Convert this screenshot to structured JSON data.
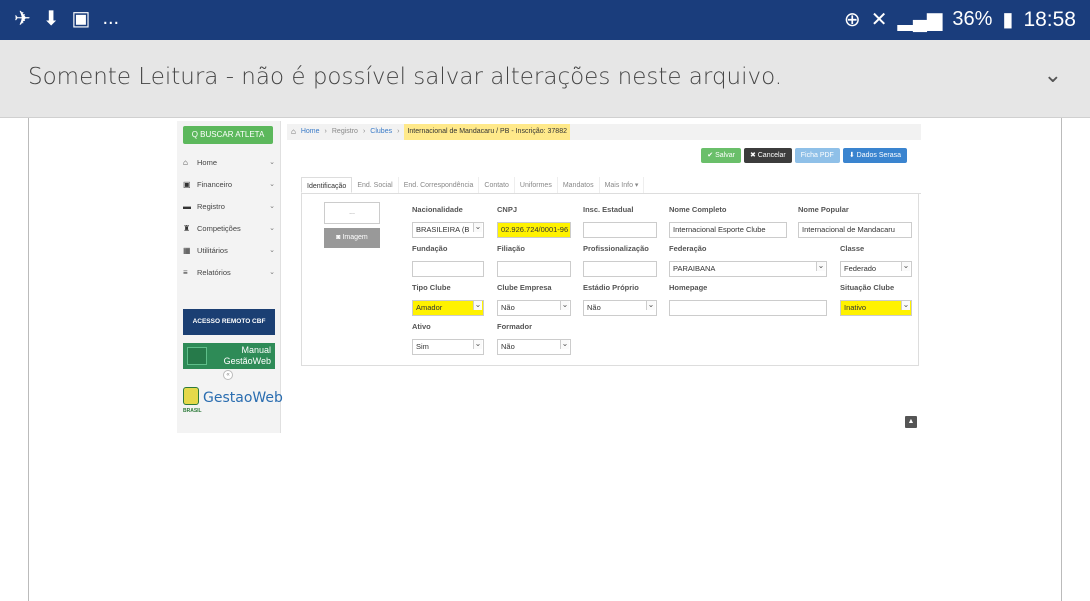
{
  "statusbar": {
    "left_icons": [
      "✈",
      "⬇",
      "▣",
      "..."
    ],
    "battery": "36%",
    "time": "18:58",
    "icons": [
      "location-icon",
      "mute-icon",
      "signal-icon",
      "battery-icon"
    ]
  },
  "banner": {
    "text": "Somente Leitura - não é possível salvar alterações neste arquivo.",
    "chevron": "⌄"
  },
  "app": {
    "sidebar": {
      "search_button": "Q BUSCAR ATLETA",
      "items": [
        {
          "icon": "home-icon",
          "glyph": "⌂",
          "label": "Home"
        },
        {
          "icon": "money-icon",
          "glyph": "▣",
          "label": "Financeiro"
        },
        {
          "icon": "briefcase-icon",
          "glyph": "▬",
          "label": "Registro"
        },
        {
          "icon": "trophy-icon",
          "glyph": "♜",
          "label": "Competições"
        },
        {
          "icon": "grid-icon",
          "glyph": "▦",
          "label": "Utilitários"
        },
        {
          "icon": "list-icon",
          "glyph": "≡",
          "label": "Relatórios"
        }
      ],
      "chevron": "⌄",
      "cbf_banner": "ACESSO REMOTO CBF",
      "manual_line1": "Manual",
      "manual_line2": "GestãoWeb",
      "collapse": "«",
      "logo": "GestaoWeb",
      "logo_sub": "BRASIL"
    },
    "breadcrumb": {
      "home": "Home",
      "registro": "Registro",
      "clubes": "Clubes",
      "current": "Internacional de Mandacaru / PB - Inscrição: 37882",
      "sep": "›"
    },
    "actions": {
      "salvar": "✔ Salvar",
      "cancelar": "✖ Cancelar",
      "ficha": "Ficha PDF",
      "serasa": "⬇ Dados Serasa"
    },
    "tabs": [
      "Identificação",
      "End. Social",
      "End. Correspondência",
      "Contato",
      "Uniformes",
      "Mandatos",
      "Mais Info ▾"
    ],
    "photo": {
      "placeholder": "...",
      "button": "Imagem"
    },
    "form": {
      "nacionalidade": {
        "label": "Nacionalidade",
        "value": "BRASILEIRA (B"
      },
      "cnpj": {
        "label": "CNPJ",
        "value": "02.926.724/0001-96"
      },
      "insc_estadual": {
        "label": "Insc. Estadual",
        "value": ""
      },
      "nome_completo": {
        "label": "Nome Completo",
        "value": "Internacional Esporte Clube"
      },
      "nome_popular": {
        "label": "Nome Popular",
        "value": "Internacional de Mandacaru"
      },
      "fundacao": {
        "label": "Fundação",
        "value": ""
      },
      "filiacao": {
        "label": "Filiação",
        "value": ""
      },
      "profissionalizacao": {
        "label": "Profissionalização",
        "value": ""
      },
      "federacao": {
        "label": "Federação",
        "value": "PARAIBANA"
      },
      "classe": {
        "label": "Classe",
        "value": "Federado"
      },
      "tipo_clube": {
        "label": "Tipo Clube",
        "value": "Amador"
      },
      "clube_empresa": {
        "label": "Clube Empresa",
        "value": "Não"
      },
      "estadio_proprio": {
        "label": "Estádio Próprio",
        "value": "Não"
      },
      "homepage": {
        "label": "Homepage",
        "value": ""
      },
      "situacao_clube": {
        "label": "Situação Clube",
        "value": "Inativo"
      },
      "ativo": {
        "label": "Ativo",
        "value": "Sim"
      },
      "formador": {
        "label": "Formador",
        "value": "Não"
      }
    },
    "scroll_top": "▲"
  },
  "colors": {
    "statusbar": "#1a3d7c",
    "highlight": "#fff200",
    "success": "#6abf6a",
    "primary": "#3a84cf"
  }
}
